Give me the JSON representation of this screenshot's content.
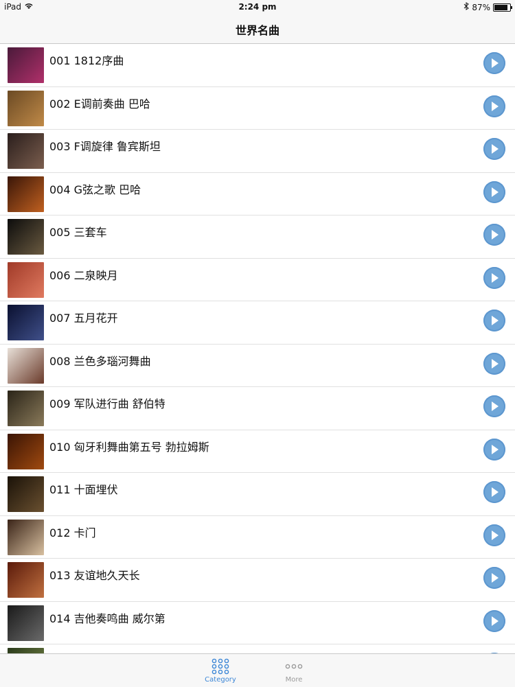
{
  "status_bar": {
    "device": "iPad",
    "time": "2:24 pm",
    "battery": "87%",
    "battery_level": 0.87
  },
  "nav": {
    "title": "世界名曲"
  },
  "list": [
    {
      "label": "001 1812序曲",
      "thumb_colors": [
        "#4a1a3a",
        "#b0306a"
      ]
    },
    {
      "label": "002 E调前奏曲 巴哈",
      "thumb_colors": [
        "#6b4a24",
        "#c08a48"
      ]
    },
    {
      "label": "003 F调旋律 鲁宾斯坦",
      "thumb_colors": [
        "#2a1e1c",
        "#7b5e4e"
      ]
    },
    {
      "label": "004 G弦之歌 巴哈",
      "thumb_colors": [
        "#3a1608",
        "#c06020"
      ]
    },
    {
      "label": "005 三套车",
      "thumb_colors": [
        "#0c0c0c",
        "#6a5a40"
      ]
    },
    {
      "label": "006 二泉映月",
      "thumb_colors": [
        "#a03a28",
        "#e07a60"
      ]
    },
    {
      "label": "007 五月花开",
      "thumb_colors": [
        "#0a1030",
        "#40508a"
      ]
    },
    {
      "label": "008 兰色多瑙河舞曲",
      "thumb_colors": [
        "#e8e0d8",
        "#6a3a2a"
      ]
    },
    {
      "label": "009 军队进行曲 舒伯特",
      "thumb_colors": [
        "#2a2418",
        "#8a7a5a"
      ]
    },
    {
      "label": "010 匈牙利舞曲第五号 勃拉姆斯",
      "thumb_colors": [
        "#3a1404",
        "#a04a10"
      ]
    },
    {
      "label": "011 十面埋伏",
      "thumb_colors": [
        "#1a1208",
        "#6a5030"
      ]
    },
    {
      "label": "012 卡门",
      "thumb_colors": [
        "#3a2418",
        "#d8c0a0"
      ]
    },
    {
      "label": "013 友谊地久天长",
      "thumb_colors": [
        "#5a1a0a",
        "#c07040"
      ]
    },
    {
      "label": "014 吉他奏鸣曲 威尔第",
      "thumb_colors": [
        "#1a1a1a",
        "#6a6a6a"
      ]
    },
    {
      "label": "",
      "thumb_colors": [
        "#2a3a1a",
        "#7a8a4a"
      ]
    }
  ],
  "tabs": [
    {
      "label": "Category",
      "active": true
    },
    {
      "label": "More",
      "active": false
    }
  ],
  "colors": {
    "accent": "#3b86d6",
    "play": "#6fa6d8",
    "inactive": "#9a9a9a"
  }
}
